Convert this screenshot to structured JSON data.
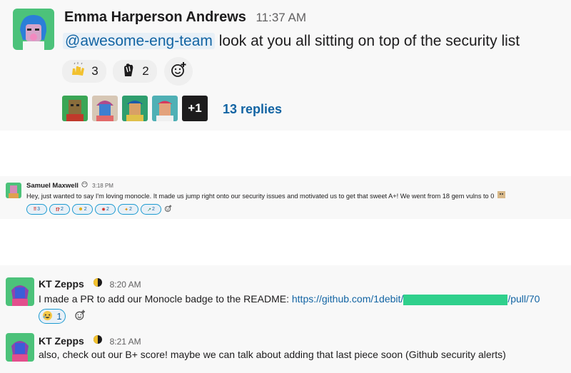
{
  "message1": {
    "author": "Emma Harperson Andrews",
    "time": "11:37 AM",
    "mention": "@awesome-eng-team",
    "text": "look at you all sitting on top of the security list",
    "reactions": [
      {
        "icon": "raised-hands-icon",
        "count": "3"
      },
      {
        "icon": "hand-icon",
        "count": "2"
      }
    ],
    "add_reaction_icon": "add-reaction-icon",
    "overflow_avatars": "+1",
    "replies": "13 replies"
  },
  "message2": {
    "author": "Samuel Maxwell",
    "time": "3:18 PM",
    "text": "Hey, just wanted to say I'm loving monocle. It made us jump right onto our security issues and motivated us to get that sweet A+! We went from 18 gem vulns to 0",
    "reactions": [
      {
        "icon": "double-exclamation-icon",
        "glyph": "‼",
        "count": "3"
      },
      {
        "icon": "exclamation-question-icon",
        "glyph": "⁉",
        "count": "2"
      },
      {
        "icon": "grinning-face-icon",
        "glyph": "☻",
        "count": "2"
      },
      {
        "icon": "crab-icon",
        "glyph": "✹",
        "count": "2"
      },
      {
        "icon": "party-popper-icon",
        "glyph": "✦",
        "count": "2"
      },
      {
        "icon": "chart-up-icon",
        "glyph": "↗",
        "count": "2"
      }
    ]
  },
  "message3": {
    "author": "KT Zepps",
    "time": "8:20 AM",
    "text": "I made a PR to add our Monocle badge to the README:",
    "link_prefix": "https://github.com/1debit/",
    "link_suffix": "/pull/70",
    "reaction": {
      "icon": "laughing-face-icon",
      "count": "1"
    }
  },
  "message4": {
    "author": "KT Zepps",
    "time": "8:21 AM",
    "text": "also, check out our B+ score! maybe we can talk about adding that last piece soon (Github security alerts)"
  },
  "colors": {
    "link": "#1264a3",
    "mention_bg": "#e8f0f7",
    "redaction": "#2fd08c",
    "panel_bg": "#f8f8f8"
  }
}
